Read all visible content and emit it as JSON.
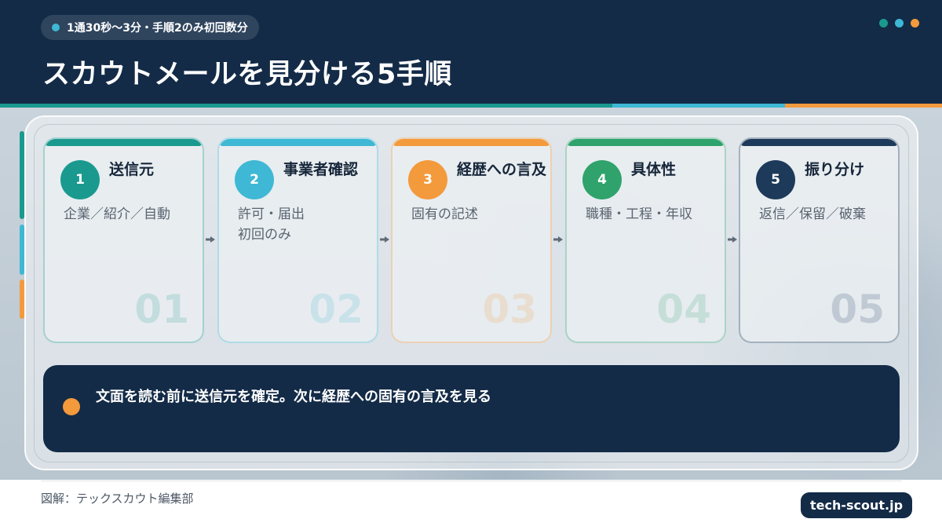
{
  "header": {
    "badge": "1通30秒〜3分・手順2のみ初回数分",
    "title": "スカウトメールを見分ける5手順",
    "dots": [
      "#1a9a8f",
      "#3eb8d4",
      "#f39a3c"
    ]
  },
  "accent_strip": [
    "#1a9a8f",
    "#3eb8d4",
    "#f39a3c"
  ],
  "steps": [
    {
      "num": "1",
      "title": "送信元",
      "desc": "企業／紹介／自動",
      "big": "01",
      "color": "#1a9a8f"
    },
    {
      "num": "2",
      "title": "事業者確認",
      "desc": "許可・届出\n初回のみ",
      "big": "02",
      "color": "#3eb8d4"
    },
    {
      "num": "3",
      "title": "経歴への言及",
      "desc": "固有の記述",
      "big": "03",
      "color": "#f39a3c"
    },
    {
      "num": "4",
      "title": "具体性",
      "desc": "職種・工程・年収",
      "big": "04",
      "color": "#2fa36b"
    },
    {
      "num": "5",
      "title": "振り分け",
      "desc": "返信／保留／破棄",
      "big": "05",
      "color": "#1d3a5a"
    }
  ],
  "note": {
    "text": "文面を読む前に送信元を確定。次に経歴への固有の言及を見る",
    "dot_color": "#f39a3c"
  },
  "footer": {
    "credit": "図解：テックスカウト編集部",
    "site": "tech-scout.jp"
  }
}
